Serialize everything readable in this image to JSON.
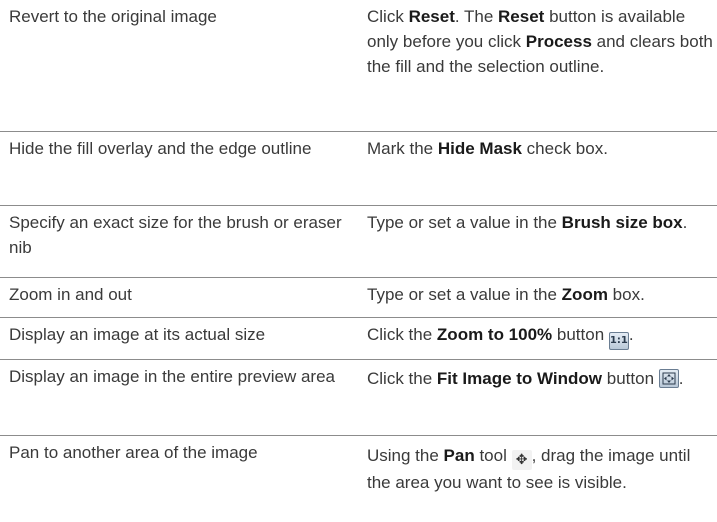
{
  "rows": [
    {
      "task": "Revert to the original image",
      "do": {
        "t1": "Click ",
        "b1": "Reset",
        "t2": ". The ",
        "b2": "Reset",
        "t3": " button is available only before you click ",
        "b3": "Process",
        "t4": " and clears both the fill and the selection outline."
      }
    },
    {
      "task": "Hide the fill overlay and the edge outline",
      "do": {
        "t1": "Mark the ",
        "b1": "Hide Mask",
        "t2": " check box."
      }
    },
    {
      "task": "Specify an exact size for the brush or eraser nib",
      "do": {
        "t1": "Type or set a value in the ",
        "b1": "Brush size box",
        "t2": "."
      }
    },
    {
      "task": "Zoom in and out",
      "do": {
        "t1": "Type or set a value in the ",
        "b1": "Zoom",
        "t2": " box."
      }
    },
    {
      "task": "Display an image at its actual size",
      "do": {
        "t1": "Click the ",
        "b1": "Zoom to 100%",
        "t2": " button ",
        "icon_label": "1:1",
        "t3": "."
      }
    },
    {
      "task": "Display an image in the entire preview area",
      "do": {
        "t1": "Click the ",
        "b1": "Fit Image to Window",
        "t2": " button ",
        "t3": "."
      }
    },
    {
      "task": "Pan to another area of the image",
      "do": {
        "t1": "Using the ",
        "b1": "Pan",
        "t2": " tool ",
        "t3": ", drag the image until the area you want to see is visible."
      }
    }
  ],
  "icons": {
    "zoom_100": "zoom-100-icon",
    "fit_window": "fit-window-icon",
    "pan": "pan-icon"
  }
}
